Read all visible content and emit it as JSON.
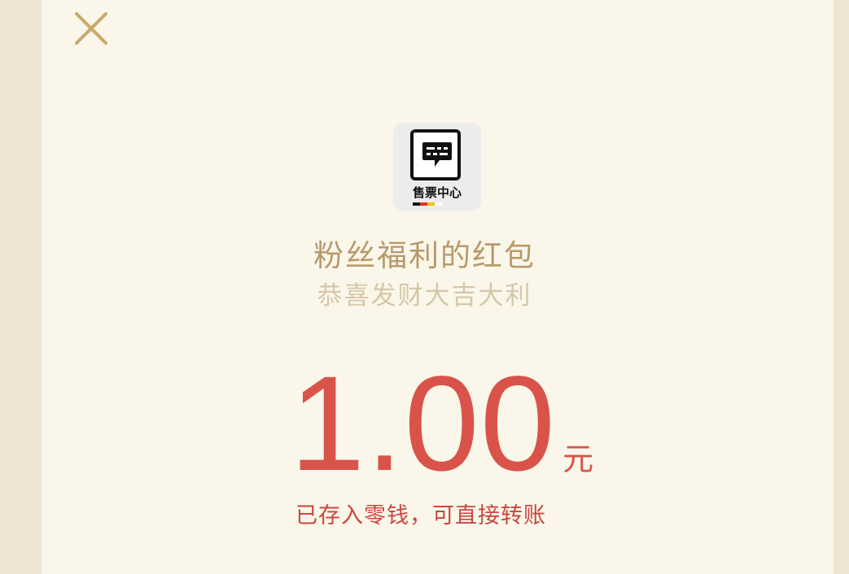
{
  "colors": {
    "page_edge": "#ede4d2",
    "card_bg": "#faf6ea",
    "gold": "#b79a6b",
    "light_gold": "#d6c7a8",
    "red": "#d9534a",
    "close_icon": "#c9a96b"
  },
  "header": {
    "close_icon": "close-icon"
  },
  "logo": {
    "icon": "chat-bubble-icon",
    "text": "售票中心",
    "stripe_colors": [
      "#111111",
      "#e03020",
      "#f2c400",
      "#ffffff"
    ]
  },
  "packet": {
    "title": "粉丝福利的红包",
    "greeting": "恭喜发财大吉大利"
  },
  "amount": {
    "value": "1.00",
    "unit": "元",
    "status": "已存入零钱，可直接转账"
  }
}
